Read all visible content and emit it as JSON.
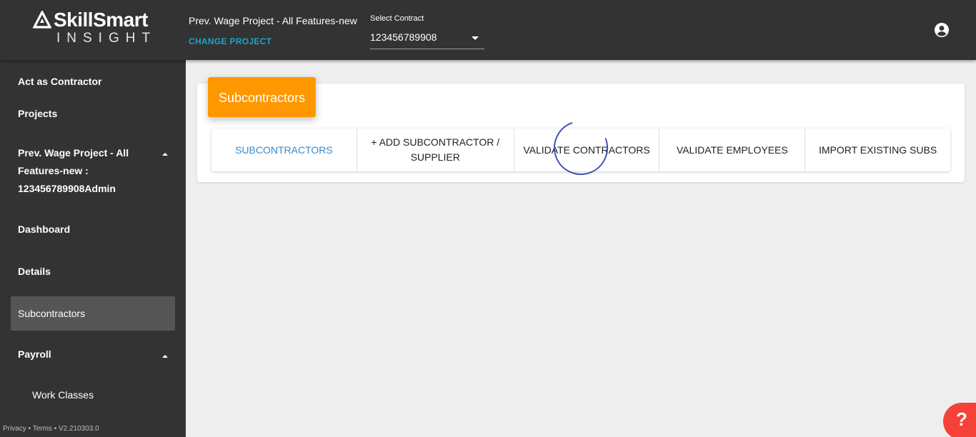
{
  "logo": {
    "name": "SkillSmart",
    "sub": "INSIGHT"
  },
  "header": {
    "project_title": "Prev. Wage Project - All Features-new",
    "change_project": "CHANGE PROJECT",
    "contract_label": "Select Contract",
    "contract_value": "123456789908",
    "account_icon": "account-circle-icon"
  },
  "sidebar": {
    "act_as": "Act as Contractor",
    "projects": "Projects",
    "project_line1": "Prev. Wage Project - All",
    "project_line2": "Features-new :",
    "project_line3": "123456789908Admin",
    "dashboard": "Dashboard",
    "details": "Details",
    "subcontractors": "Subcontractors",
    "payroll": "Payroll",
    "work_classes": "Work Classes",
    "footer_privacy": "Privacy",
    "footer_terms": "Terms",
    "footer_version": "V2.210303.0"
  },
  "main": {
    "card_title": "Subcontractors",
    "tabs": [
      {
        "label": "SUBCONTRACTORS"
      },
      {
        "label": "+ ADD SUBCONTRACTOR / SUPPLIER"
      },
      {
        "label": "VALIDATE CONTRACTORS"
      },
      {
        "label": "VALIDATE EMPLOYEES"
      },
      {
        "label": "IMPORT EXISTING SUBS"
      }
    ]
  },
  "help": {
    "label": "?"
  },
  "colors": {
    "topbar": "#333333",
    "sidebar": "#333333",
    "accent_orange": "#ff9800",
    "active_tab": "#3a8ac9",
    "change_project": "#1aa6c8",
    "help": "#f44336"
  }
}
